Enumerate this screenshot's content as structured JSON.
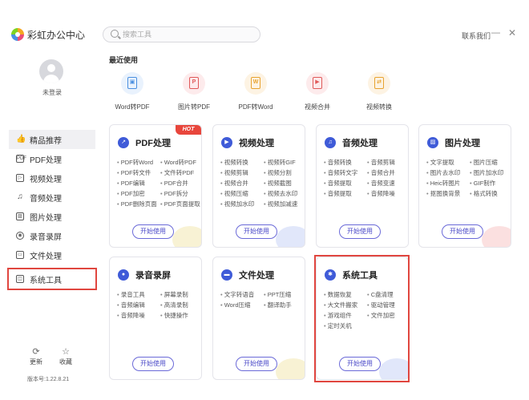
{
  "app": {
    "title": "彩虹办公中心"
  },
  "search": {
    "placeholder": "搜索工具"
  },
  "window": {
    "contact": "联系我们",
    "minimize": "—",
    "close": "✕"
  },
  "user": {
    "login_label": "未登录"
  },
  "nav": {
    "items": [
      {
        "label": "精品推荐",
        "icon": "thumbs-up-icon",
        "glyph": "👍"
      },
      {
        "label": "PDF处理",
        "icon": "pdf-icon",
        "glyph": "PDF"
      },
      {
        "label": "视频处理",
        "icon": "video-icon",
        "glyph": "▷"
      },
      {
        "label": "音频处理",
        "icon": "music-icon",
        "glyph": "♫"
      },
      {
        "label": "图片处理",
        "icon": "image-icon",
        "glyph": "▨"
      },
      {
        "label": "录音录屏",
        "icon": "record-icon",
        "glyph": "◉"
      },
      {
        "label": "文件处理",
        "icon": "folder-icon",
        "glyph": "▭"
      },
      {
        "label": "系统工具",
        "icon": "system-icon",
        "glyph": "◫"
      }
    ],
    "active_index": 0,
    "highlighted_index": 7
  },
  "bottom": {
    "update_label": "更新",
    "favorite_label": "收藏",
    "version": "版本号:1.22.8.21"
  },
  "recent": {
    "title": "最近使用",
    "items": [
      {
        "label": "Word转PDF",
        "icon": "image-file-icon",
        "glyph": "▣",
        "color": "#4a8fe0",
        "bg": "#e9f2fd"
      },
      {
        "label": "图片转PDF",
        "icon": "pdf-file-icon",
        "glyph": "P",
        "color": "#e05a5a",
        "bg": "#fdebec"
      },
      {
        "label": "PDF转Word",
        "icon": "word-file-icon",
        "glyph": "W",
        "color": "#e8a330",
        "bg": "#fdf3e3"
      },
      {
        "label": "视频合并",
        "icon": "video-merge-icon",
        "glyph": "▶",
        "color": "#e05a5a",
        "bg": "#fdebec"
      },
      {
        "label": "视频转换",
        "icon": "video-convert-icon",
        "glyph": "⇄",
        "color": "#e8a330",
        "bg": "#fdf3e3"
      }
    ]
  },
  "cards": [
    {
      "title": "PDF处理",
      "icon": "pdf-icon",
      "glyph": "↗",
      "hot": "HOT",
      "features": [
        "PDF转Word",
        "Word转PDF",
        "PDF转文件",
        "文件转PDF",
        "PDF编辑",
        "PDF合并",
        "PDF加密",
        "PDF拆分",
        "PDF删除页面",
        "PDF页面提取"
      ],
      "button": "开始使用",
      "deco": "#f3e7b0"
    },
    {
      "title": "视频处理",
      "icon": "video-icon",
      "glyph": "▶",
      "features": [
        "视频转换",
        "视频转GIF",
        "视频剪辑",
        "视频分割",
        "视频合并",
        "视频截图",
        "视频压缩",
        "视频去水印",
        "视频加水印",
        "视频加减速"
      ],
      "button": "开始使用",
      "deco": "#c9d4f5"
    },
    {
      "title": "音频处理",
      "icon": "music-icon",
      "glyph": "♫",
      "features": [
        "音频转换",
        "音频剪辑",
        "音频转文字",
        "音频合并",
        "音频提取",
        "音频变速",
        "音频提取",
        "音频降噪"
      ],
      "button": "开始使用",
      "deco": "#ffffff"
    },
    {
      "title": "图片处理",
      "icon": "image-icon",
      "glyph": "▨",
      "features": [
        "文字提取",
        "图片压缩",
        "图片去水印",
        "图片加水印",
        "Heic转图片",
        "GIF制作",
        "抠图换背景",
        "格式转换"
      ],
      "button": "开始使用",
      "deco": "#f7c6c6"
    },
    {
      "title": "录音录屏",
      "icon": "mic-icon",
      "glyph": "●",
      "features": [
        "录音工具",
        "屏幕录制",
        "音频编辑",
        "高清录制",
        "音频降噪",
        "快捷操作"
      ],
      "button": "开始使用",
      "deco": "#ffffff"
    },
    {
      "title": "文件处理",
      "icon": "folder-icon",
      "glyph": "▬",
      "features": [
        "文字转语音",
        "PPT压缩",
        "Word压缩",
        "翻译助手"
      ],
      "button": "开始使用",
      "deco": "#f3e7b0"
    },
    {
      "title": "系统工具",
      "icon": "gear-icon",
      "glyph": "✱",
      "features": [
        "数据恢复",
        "C盘清理",
        "大文件搬家",
        "驱动管理",
        "游戏组件",
        "文件加密",
        "定时关机"
      ],
      "button": "开始使用",
      "deco": "#c9d4f5"
    }
  ]
}
